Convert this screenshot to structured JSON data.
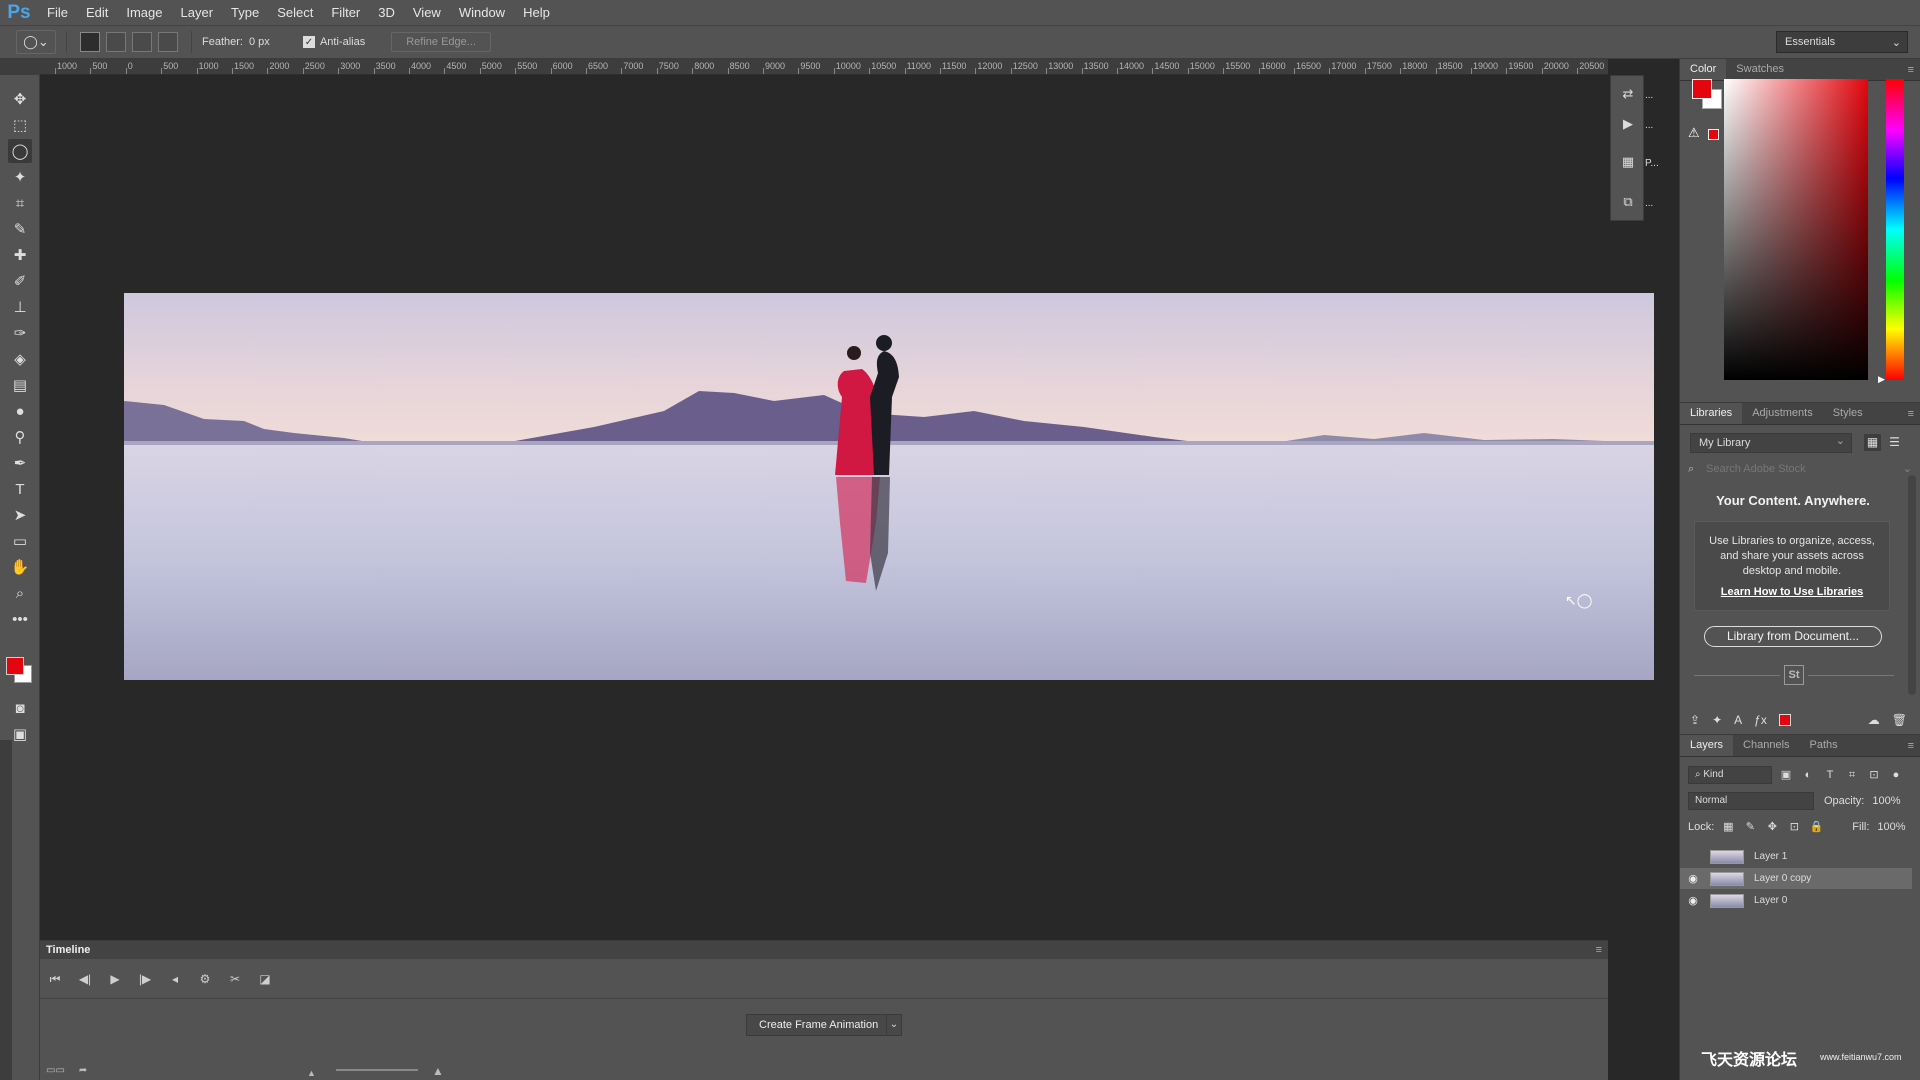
{
  "app": {
    "logo": "Ps"
  },
  "menu": [
    "File",
    "Edit",
    "Image",
    "Layer",
    "Type",
    "Select",
    "Filter",
    "3D",
    "View",
    "Window",
    "Help"
  ],
  "options": {
    "feather_label": "Feather:",
    "feather_value": "0 px",
    "antialias_label": "Anti-alias",
    "refine_label": "Refine Edge...",
    "workspace": "Essentials"
  },
  "ruler_labels": [
    "1000",
    "500",
    "0",
    "500",
    "1000",
    "1500",
    "2000",
    "2500",
    "3000",
    "3500",
    "4000",
    "4500",
    "5000",
    "5500",
    "6000",
    "6500",
    "7000",
    "7500",
    "8000",
    "8500",
    "9000",
    "9500",
    "10000",
    "10500",
    "11000",
    "11500",
    "12000",
    "12500",
    "13000",
    "13500",
    "14000",
    "14500",
    "15000",
    "15500",
    "16000",
    "16500",
    "17000",
    "17500",
    "18000",
    "18500",
    "19000",
    "19500",
    "20000",
    "20500"
  ],
  "color_panel": {
    "tabs": [
      "Color",
      "Swatches"
    ],
    "fg_color": "#e3060e",
    "bg_color": "#ffffff"
  },
  "mini_panel": {
    "items": [
      "...",
      "...",
      "P...",
      "..."
    ]
  },
  "libraries": {
    "tabs": [
      "Libraries",
      "Adjustments",
      "Styles"
    ],
    "library": "My Library",
    "search_placeholder": "Search Adobe Stock",
    "headline": "Your Content. Anywhere.",
    "description": "Use Libraries to organize, access, and share your assets across desktop and mobile.",
    "link": "Learn How to Use Libraries",
    "doc_button": "Library from Document...",
    "stock_icon": "St"
  },
  "layers_panel": {
    "tabs": [
      "Layers",
      "Channels",
      "Paths"
    ],
    "filter_kind": "Kind",
    "blend_mode": "Normal",
    "opacity_label": "Opacity:",
    "opacity_value": "100%",
    "lock_label": "Lock:",
    "fill_label": "Fill:",
    "fill_value": "100%",
    "layers": [
      {
        "name": "Layer 1",
        "visible": false,
        "selected": false
      },
      {
        "name": "Layer 0 copy",
        "visible": true,
        "selected": true
      },
      {
        "name": "Layer 0",
        "visible": true,
        "selected": false
      }
    ]
  },
  "timeline": {
    "title": "Timeline",
    "create_button": "Create Frame Animation"
  },
  "watermark": {
    "text": "飞天资源论坛",
    "url": "www.feitianwu7.com"
  }
}
